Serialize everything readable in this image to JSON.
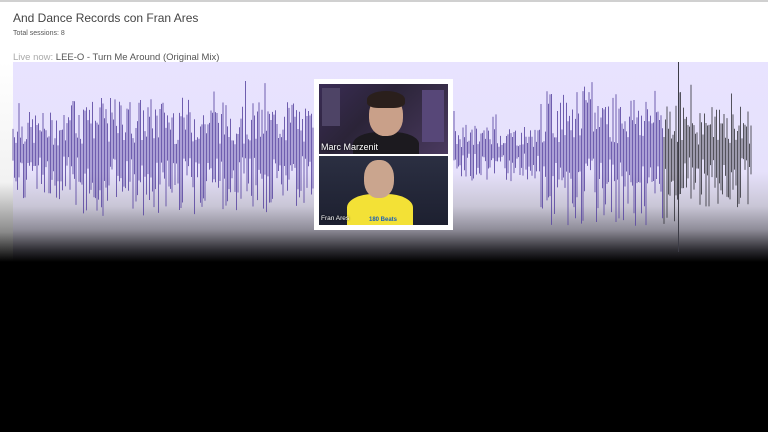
{
  "session": {
    "title": "And Dance Records con Fran Ares",
    "total_sessions": "Total sessions: 8"
  },
  "live": {
    "prefix": "Live now:",
    "track": "LEE-O - Turn Me Around (Original Mix)"
  },
  "player": {
    "played_fraction": 0.88
  },
  "video": {
    "participants": [
      {
        "name": "Marc Marzenit"
      },
      {
        "name": "Fran Ares"
      }
    ],
    "shirt_text": "180 Beats"
  },
  "colors": {
    "played_wave": "#5b48a2",
    "unplayed_wave": "#2f2f35",
    "wave_background": "#e8e3ff"
  }
}
